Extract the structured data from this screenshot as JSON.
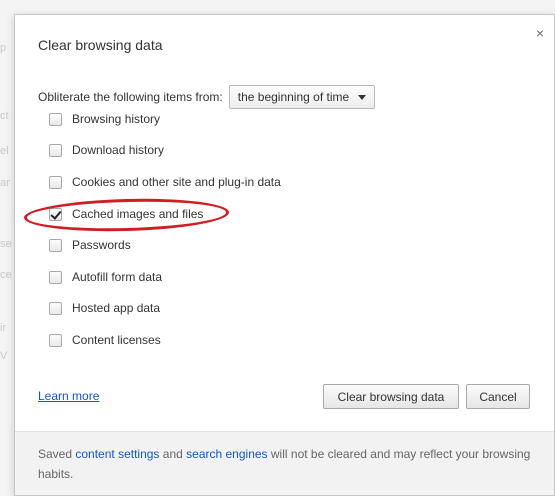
{
  "dialog": {
    "title": "Clear browsing data",
    "close_glyph": "×"
  },
  "time_range": {
    "label": "Obliterate the following items from:",
    "selected": "the beginning of time"
  },
  "options": [
    {
      "label": "Browsing history",
      "checked": false
    },
    {
      "label": "Download history",
      "checked": false
    },
    {
      "label": "Cookies and other site and plug-in data",
      "checked": false
    },
    {
      "label": "Cached images and files",
      "checked": true
    },
    {
      "label": "Passwords",
      "checked": false
    },
    {
      "label": "Autofill form data",
      "checked": false
    },
    {
      "label": "Hosted app data",
      "checked": false
    },
    {
      "label": "Content licenses",
      "checked": false
    }
  ],
  "links": {
    "learn_more": "Learn more"
  },
  "buttons": {
    "clear": "Clear browsing data",
    "cancel": "Cancel"
  },
  "footer": {
    "text_1": "Saved",
    "link_content_settings": "content settings",
    "text_2": "and",
    "link_search_engines": "search engines",
    "text_3": "will not be cleared and may reflect your browsing habits."
  },
  "background_letters": [
    "p",
    "ct",
    "el",
    "ar",
    "se",
    "ce",
    "ir",
    "V"
  ],
  "colors": {
    "link": "#1155cc",
    "highlight_annotation": "#d11c24"
  }
}
